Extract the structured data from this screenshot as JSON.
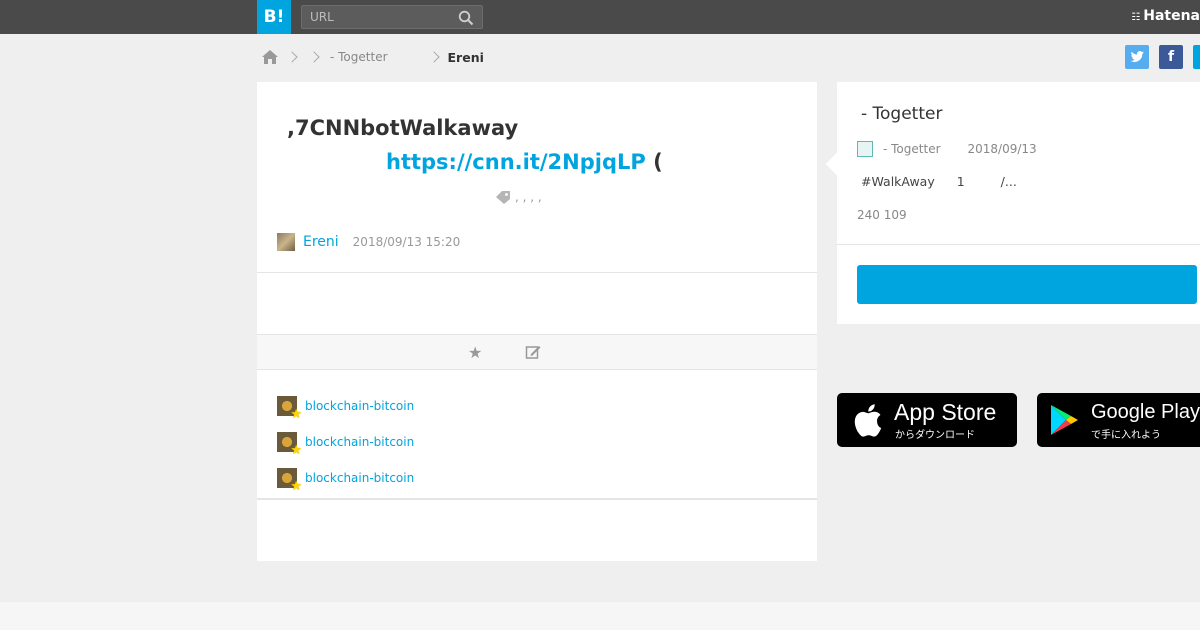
{
  "header": {
    "logo": "B!",
    "search_placeholder": "URL",
    "brand": "Hatena"
  },
  "breadcrumb": {
    "item1": "- Togetter",
    "current": "Ereni"
  },
  "share": {
    "twitter": "t",
    "facebook": "f",
    "third": "B"
  },
  "entry": {
    "title_line1": ",7CNNbotWalkaway",
    "title_link": "https://cnn.it/2NpjqLP",
    "title_suffix": "(",
    "tags": ", , , ,",
    "author": "Ereni",
    "date": "2018/09/13 15:20"
  },
  "stars": [
    {
      "user": "blockchain-bitcoin"
    },
    {
      "user": "blockchain-bitcoin"
    },
    {
      "user": "blockchain-bitcoin"
    }
  ],
  "panel": {
    "title": "- Togetter",
    "site": "- Togetter",
    "date": "2018/09/13",
    "desc_tag": "#WalkAway",
    "desc_num": "1",
    "desc_more": "/...",
    "count": "240 109"
  },
  "stores": {
    "appstore_big": "App Store",
    "appstore_small": "からダウンロード",
    "google_big": "Google Play",
    "google_small": "で手に入れよう"
  },
  "colors": {
    "accent": "#00a4de",
    "topbar": "#4a4a4a"
  }
}
